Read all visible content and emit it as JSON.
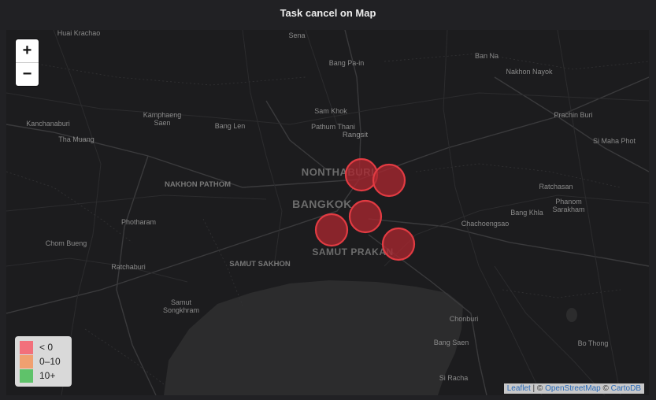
{
  "panel": {
    "title": "Task cancel on Map"
  },
  "zoom": {
    "in_label": "+",
    "out_label": "−"
  },
  "places": {
    "huai_krachao": "Huai Krachao",
    "sena": "Sena",
    "bang_pa_in": "Bang Pa-in",
    "ban_na": "Ban Na",
    "nakhon_nayok": "Nakhon Nayok",
    "sam_khok": "Sam Khok",
    "kanchanaburi": "Kanchanaburi",
    "kamphaeng_saen": "Kamphaeng Saen",
    "bang_len": "Bang Len",
    "pathum_thani": "Pathum Thani",
    "rangsit": "Rangsit",
    "prachin_buri": "Prachin Buri",
    "tha_muang": "Tha Muang",
    "si_maha_phot": "Si Maha Phot",
    "nonthaburi": "NONTHABURI",
    "nakhon_pathom": "NAKHON PATHOM",
    "bangkok": "BANGKOK",
    "ratchasan": "Ratchasan",
    "bang_khla": "Bang Khla",
    "phanom_sarakham": "Phanom Sarakham",
    "photharam": "Photharam",
    "chachoengsao": "Chachoengsao",
    "chom_bueng": "Chom Bueng",
    "samut_prakan": "SAMUT PRAKAN",
    "ratchaburi": "Ratchaburi",
    "samut_sakhon": "SAMUT SAKHON",
    "samut_songkhram": "Samut Songkhram",
    "chonburi": "Chonburi",
    "bang_saen": "Bang Saen",
    "bo_thong": "Bo Thong",
    "si_racha": "Si Racha"
  },
  "markers": [
    {
      "id": "marker-nonthaburi",
      "status": "< 0"
    },
    {
      "id": "marker-rangsit-east",
      "status": "< 0"
    },
    {
      "id": "marker-bangkok-center",
      "status": "< 0"
    },
    {
      "id": "marker-bangkok-west",
      "status": "< 0"
    },
    {
      "id": "marker-samut-prakan",
      "status": "< 0"
    }
  ],
  "legend": [
    {
      "label": "< 0",
      "color": "#f2707b"
    },
    {
      "label": "0–10",
      "color": "#f0a070"
    },
    {
      "label": "10+",
      "color": "#5fc26a"
    }
  ],
  "attribution": {
    "leaflet": "Leaflet",
    "sep1": " | © ",
    "osm": "OpenStreetMap",
    "sep2": " © ",
    "carto": "CartoDB"
  },
  "colors": {
    "land": "#1c1c1e",
    "sea": "#2c2c2d",
    "marker_fill": "#a8262f",
    "marker_stroke": "#e23b42"
  }
}
